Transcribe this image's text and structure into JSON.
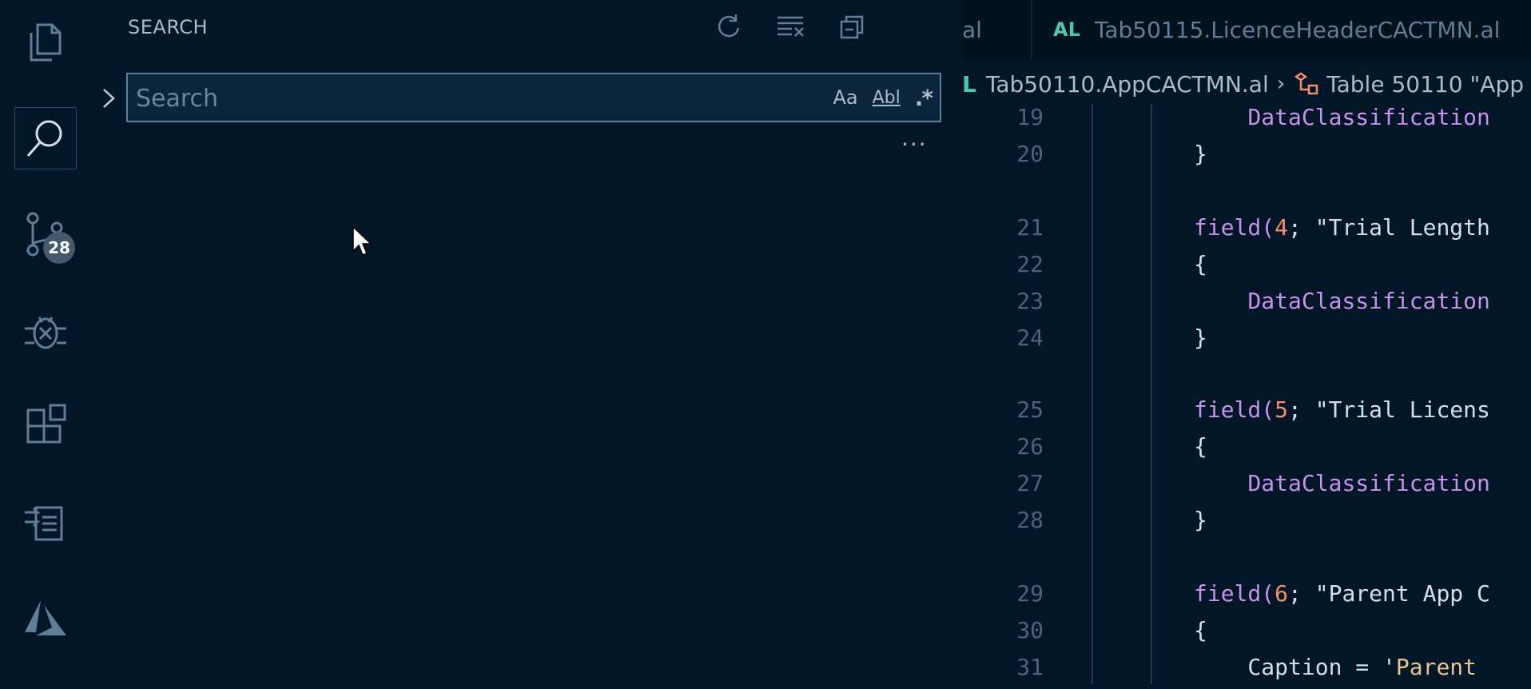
{
  "activity_bar": {
    "items": [
      {
        "icon": "files-icon"
      },
      {
        "icon": "search-icon",
        "active": true
      },
      {
        "icon": "source-control-icon",
        "badge": "28"
      },
      {
        "icon": "debug-icon"
      },
      {
        "icon": "extensions-icon"
      },
      {
        "icon": "remote-explorer-icon"
      },
      {
        "icon": "azure-icon"
      }
    ]
  },
  "search_panel": {
    "title": "SEARCH",
    "search_placeholder": "Search",
    "match_case_label": "Aa",
    "whole_word_label": "Abl",
    "regex_label": ".*",
    "more_label": "..."
  },
  "editor": {
    "tabs": [
      {
        "label": "al"
      },
      {
        "lang": "AL",
        "label": "Tab50115.LicenceHeaderCACTMN.al"
      }
    ],
    "breadcrumb": {
      "lang": "L",
      "file": "Tab50110.AppCACTMN.al",
      "symbol": "Table 50110 \"App"
    },
    "lines": [
      {
        "n": "19",
        "segs": [
          [
            "        ",
            "pln"
          ],
          [
            "DataClassification",
            "kw"
          ]
        ]
      },
      {
        "n": "20",
        "segs": [
          [
            "    }",
            "pln"
          ]
        ]
      },
      {
        "n": "21",
        "segs": [
          [
            "    ",
            "pln"
          ],
          [
            "field(",
            "kw"
          ],
          [
            "4",
            "num"
          ],
          [
            "; \"Trial Length",
            "pln"
          ]
        ]
      },
      {
        "n": "22",
        "segs": [
          [
            "    {",
            "pln"
          ]
        ]
      },
      {
        "n": "23",
        "segs": [
          [
            "        ",
            "pln"
          ],
          [
            "DataClassification",
            "kw"
          ]
        ]
      },
      {
        "n": "24",
        "segs": [
          [
            "    }",
            "pln"
          ]
        ]
      },
      {
        "n": "25",
        "segs": [
          [
            "    ",
            "pln"
          ],
          [
            "field(",
            "kw"
          ],
          [
            "5",
            "num"
          ],
          [
            "; \"Trial Licens",
            "pln"
          ]
        ]
      },
      {
        "n": "26",
        "segs": [
          [
            "    {",
            "pln"
          ]
        ]
      },
      {
        "n": "27",
        "segs": [
          [
            "        ",
            "pln"
          ],
          [
            "DataClassification",
            "kw"
          ]
        ]
      },
      {
        "n": "28",
        "segs": [
          [
            "    }",
            "pln"
          ]
        ]
      },
      {
        "n": "29",
        "segs": [
          [
            "    ",
            "pln"
          ],
          [
            "field(",
            "kw"
          ],
          [
            "6",
            "num"
          ],
          [
            "; \"Parent App C",
            "pln"
          ]
        ]
      },
      {
        "n": "30",
        "segs": [
          [
            "    {",
            "pln"
          ]
        ]
      },
      {
        "n": "31",
        "segs": [
          [
            "        Caption = '",
            "pln"
          ],
          [
            "Parent ",
            "str"
          ]
        ]
      }
    ]
  }
}
